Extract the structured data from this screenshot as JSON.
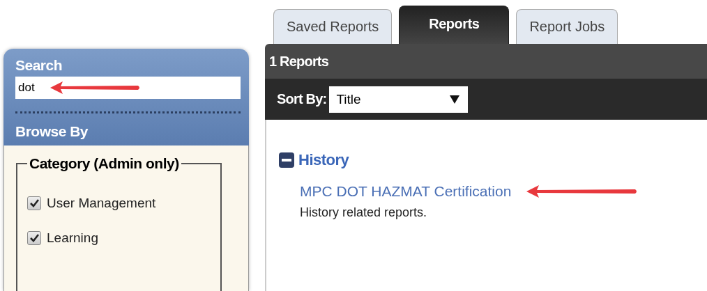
{
  "sidebar": {
    "search_label": "Search",
    "search_value": "dot",
    "browse_label": "Browse By",
    "category": {
      "legend": "Category (Admin only)",
      "items": [
        {
          "label": "User Management",
          "checked": true
        },
        {
          "label": "Learning",
          "checked": true
        }
      ]
    }
  },
  "tabs": [
    {
      "label": "Saved Reports",
      "selected": false
    },
    {
      "label": "Reports",
      "selected": true
    },
    {
      "label": "Report Jobs",
      "selected": false
    }
  ],
  "results": {
    "count": "1 Reports",
    "sort_label": "Sort By:",
    "sort_value": "Title",
    "groups": [
      {
        "title": "History",
        "expanded": true,
        "reports": [
          {
            "title": "MPC DOT HAZMAT Certification",
            "description": "History related reports."
          }
        ]
      }
    ]
  }
}
